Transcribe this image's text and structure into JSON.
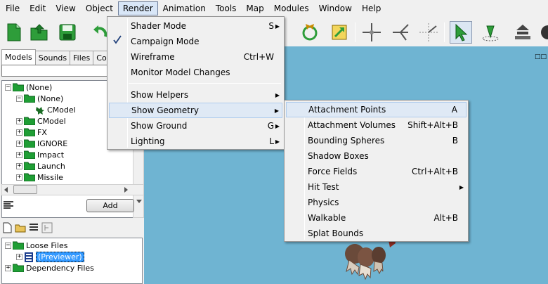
{
  "menubar": [
    "File",
    "Edit",
    "View",
    "Object",
    "Render",
    "Animation",
    "Tools",
    "Map",
    "Modules",
    "Window",
    "Help"
  ],
  "left": {
    "tabs": [
      "Models",
      "Sounds",
      "Files",
      "Co"
    ],
    "tree": [
      {
        "label": "(None)",
        "indent": 0,
        "expander": "-",
        "icon": "folder"
      },
      {
        "label": "(None)",
        "indent": 1,
        "expander": "-",
        "icon": "folder"
      },
      {
        "label": "CModel",
        "indent": 2,
        "expander": "",
        "icon": "model"
      },
      {
        "label": "CModel",
        "indent": 1,
        "expander": "+",
        "icon": "folder"
      },
      {
        "label": "FX",
        "indent": 1,
        "expander": "+",
        "icon": "folder"
      },
      {
        "label": "IGNORE",
        "indent": 1,
        "expander": "+",
        "icon": "folder"
      },
      {
        "label": "Impact",
        "indent": 1,
        "expander": "+",
        "icon": "folder"
      },
      {
        "label": "Launch",
        "indent": 1,
        "expander": "+",
        "icon": "folder"
      },
      {
        "label": "Missile",
        "indent": 1,
        "expander": "+",
        "icon": "folder"
      }
    ],
    "add_label": "Add",
    "tree2": [
      {
        "label": "Loose Files",
        "indent": 0,
        "expander": "-",
        "icon": "folder"
      },
      {
        "label": "(Previewer)",
        "indent": 1,
        "expander": "+",
        "icon": "preview",
        "selected": true
      },
      {
        "label": "Dependency Files",
        "indent": 0,
        "expander": "+",
        "icon": "folder"
      }
    ]
  },
  "render_menu": [
    {
      "label": "Shader Mode",
      "shortcut": "S",
      "submenu": true
    },
    {
      "label": "Campaign Mode",
      "checked": true
    },
    {
      "label": "Wireframe",
      "shortcut": "Ctrl+W"
    },
    {
      "label": "Monitor Model Changes"
    },
    {
      "separator": true
    },
    {
      "label": "Show Helpers",
      "submenu": true
    },
    {
      "label": "Show Geometry",
      "submenu": true,
      "highlighted": true
    },
    {
      "label": "Show Ground",
      "shortcut": "G",
      "submenu": true
    },
    {
      "label": "Lighting",
      "shortcut": "L",
      "submenu": true
    }
  ],
  "geometry_menu": [
    {
      "label": "Attachment Points",
      "shortcut": "A",
      "highlighted": true
    },
    {
      "label": "Attachment Volumes",
      "shortcut": "Shift+Alt+B"
    },
    {
      "label": "Bounding Spheres",
      "shortcut": "B"
    },
    {
      "label": "Shadow Boxes"
    },
    {
      "label": "Force Fields",
      "shortcut": "Ctrl+Alt+B"
    },
    {
      "label": "Hit Test",
      "submenu": true
    },
    {
      "label": "Physics"
    },
    {
      "label": "Walkable",
      "shortcut": "Alt+B"
    },
    {
      "label": "Splat Bounds"
    }
  ],
  "colors": {
    "viewport": "#6fb4d2",
    "highlight": "#dfe9f5",
    "selection": "#3399ff"
  },
  "toolbar_icons": [
    "new-icon",
    "open-icon",
    "save-icon",
    "undo-icon",
    "rotate-icon",
    "scale-icon",
    "axis-x-icon",
    "axis-y-icon",
    "axis-z-icon",
    "select-arrow-icon",
    "place-icon",
    "terrain-icon",
    "misc-icon"
  ]
}
